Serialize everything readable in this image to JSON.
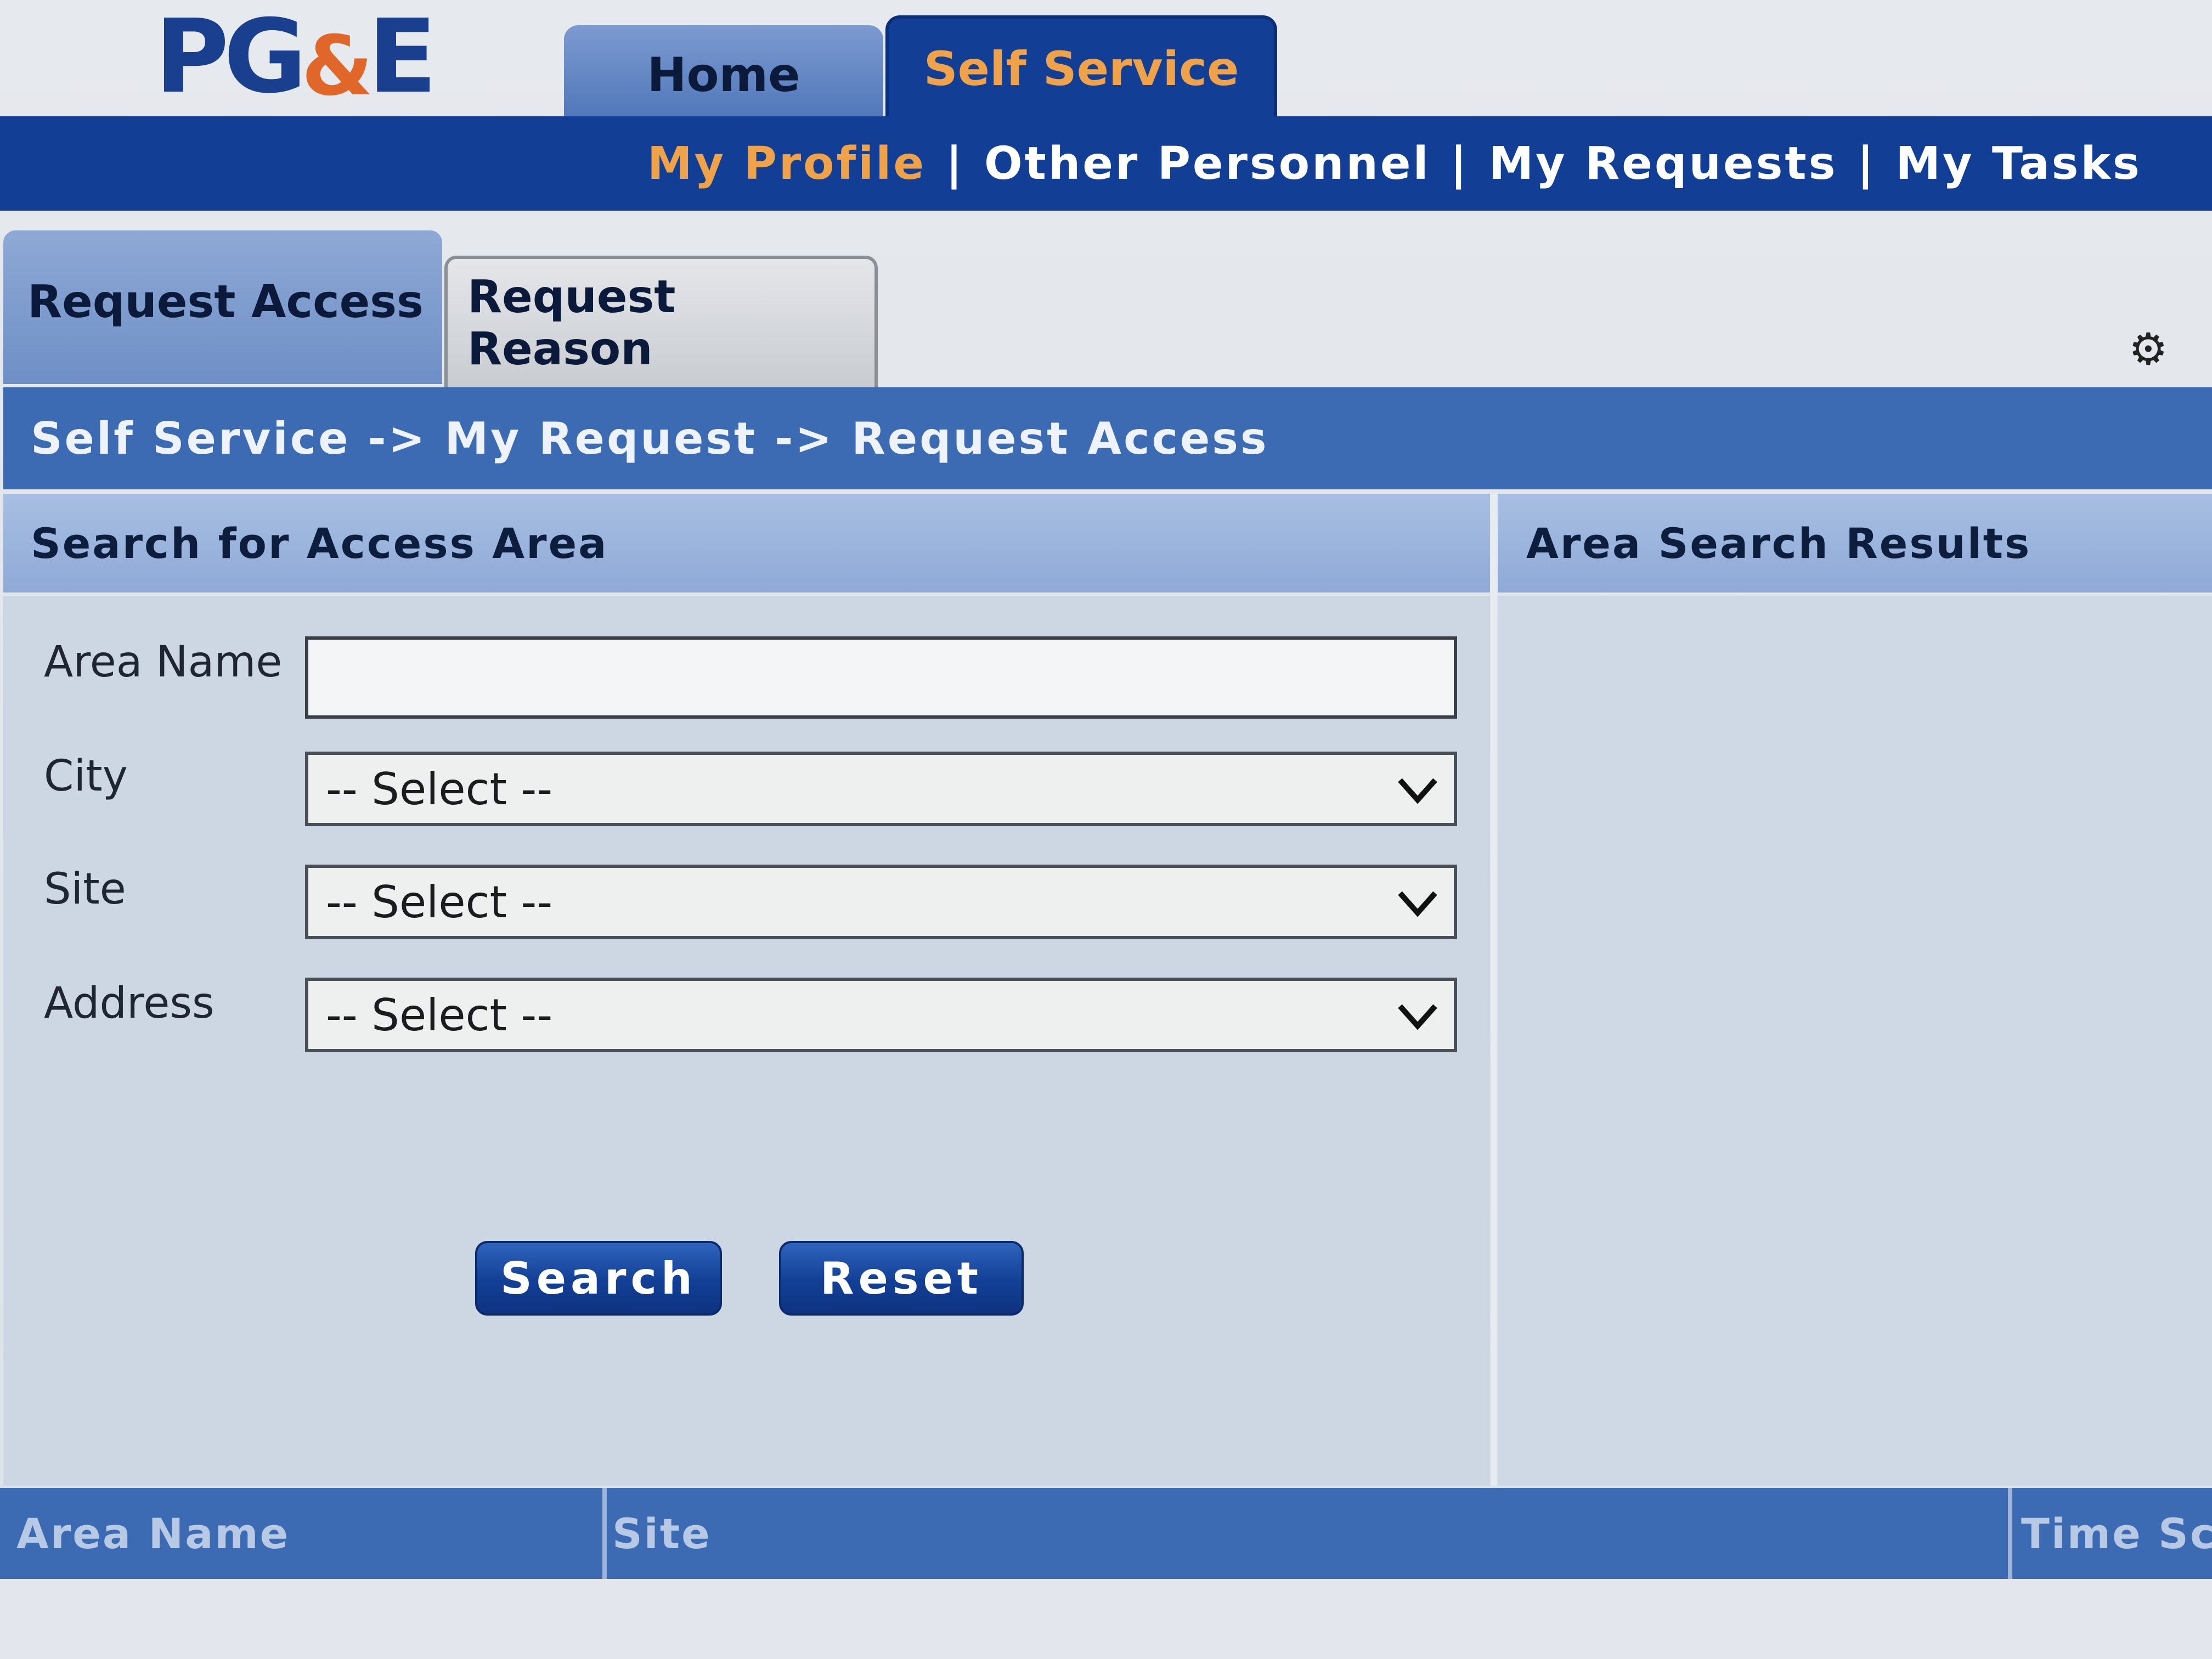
{
  "logo": {
    "pg": "PG",
    "amp": "&",
    "e": "E"
  },
  "top_tabs": [
    {
      "label": "Home",
      "active": false
    },
    {
      "label": "Self Service",
      "active": true
    }
  ],
  "subnav": {
    "items": [
      "My Profile",
      "Other Personnel",
      "My Requests",
      "My Tasks"
    ],
    "separator": "|",
    "active_index": 0
  },
  "inner_tabs": [
    {
      "label": "Request Access",
      "active": true
    },
    {
      "label": "Request Reason",
      "active": false
    }
  ],
  "breadcrumb": "Self Service -> My Request -> Request Access",
  "search_panel": {
    "title": "Search for Access Area",
    "fields": {
      "area_name": {
        "label": "Area Name",
        "value": ""
      },
      "city": {
        "label": "City",
        "selected": "-- Select --"
      },
      "site": {
        "label": "Site",
        "selected": "-- Select --"
      },
      "address": {
        "label": "Address",
        "selected": "-- Select --"
      }
    },
    "buttons": {
      "search": "Search",
      "reset": "Reset"
    }
  },
  "results_panel": {
    "title": "Area Search Results"
  },
  "table": {
    "columns": [
      "Area Name",
      "Site",
      "Time Sc"
    ]
  },
  "colors": {
    "primary_blue": "#123f95",
    "accent_orange": "#f0a24a",
    "header_blue": "#3d6bb3"
  },
  "icons": {
    "corner": "tools-icon",
    "dropdown": "chevron-down-icon"
  }
}
